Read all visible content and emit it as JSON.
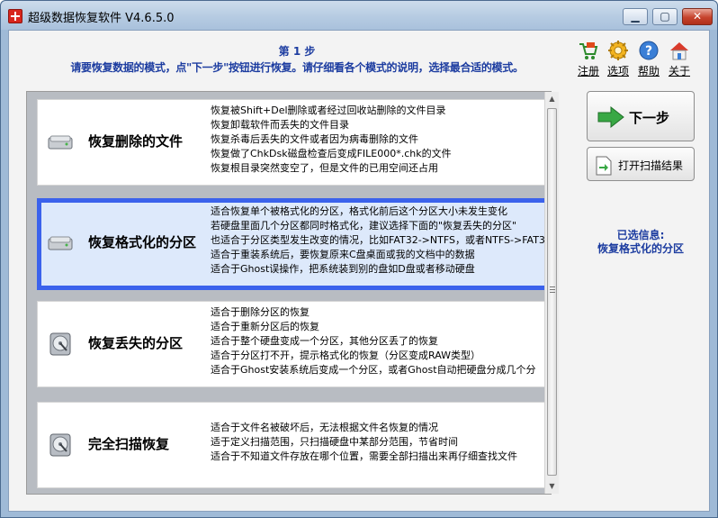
{
  "window": {
    "title": "超级数据恢复软件 V4.6.5.0"
  },
  "header": {
    "step": "第 1 步",
    "instruction": "请要恢复数据的模式，点\"下一步\"按钮进行恢复。请仔细看各个模式的说明，选择最合适的模式。"
  },
  "toolbar": [
    {
      "label": "注册",
      "icon": "cart-icon"
    },
    {
      "label": "选项",
      "icon": "gear-icon"
    },
    {
      "label": "帮助",
      "icon": "help-icon"
    },
    {
      "label": "关于",
      "icon": "home-icon"
    }
  ],
  "modes": [
    {
      "title": "恢复删除的文件",
      "icon": "disk-icon",
      "selected": false,
      "lines": [
        "恢复被Shift+Del删除或者经过回收站删除的文件目录",
        "恢复卸载软件而丢失的文件目录",
        "恢复杀毒后丢失的文件或者因为病毒删除的文件",
        "恢复做了ChkDsk磁盘检查后变成FILE000*.chk的文件",
        "恢复根目录突然变空了，但是文件的已用空间还占用"
      ]
    },
    {
      "title": "恢复格式化的分区",
      "icon": "disk-icon",
      "selected": true,
      "lines": [
        "适合恢复单个被格式化的分区，格式化前后这个分区大小未发生变化",
        "若硬盘里面几个分区都同时格式化，建议选择下面的\"恢复丢失的分区\"",
        "也适合于分区类型发生改变的情况，比如FAT32->NTFS，或者NTFS->FAT3",
        "适合于重装系统后，要恢复原来C盘桌面或我的文档中的数据",
        "适合于Ghost误操作，把系统装到别的盘如D盘或者移动硬盘"
      ]
    },
    {
      "title": "恢复丢失的分区",
      "icon": "harddrive-icon",
      "selected": false,
      "lines": [
        "适合于删除分区的恢复",
        "适合于重新分区后的恢复",
        "适合于整个硬盘变成一个分区，其他分区丢了的恢复",
        "适合于分区打不开，提示格式化的恢复（分区变成RAW类型）",
        "适合于Ghost安装系统后变成一个分区，或者Ghost自动把硬盘分成几个分"
      ]
    },
    {
      "title": "完全扫描恢复",
      "icon": "harddrive-icon",
      "selected": false,
      "lines": [
        "适合于文件名被破坏后，无法根据文件名恢复的情况",
        "适于定义扫描范围，只扫描硬盘中某部分范围，节省时间",
        "适合于不知道文件存放在哪个位置，需要全部扫描出来再仔细查找文件"
      ]
    }
  ],
  "actions": {
    "next_label": "下一步",
    "open_label": "打开扫描结果"
  },
  "selection": {
    "label": "已选信息:",
    "value": "恢复格式化的分区"
  },
  "colors": {
    "accent_text": "#1c3ca0",
    "selected_border": "#3b62ec",
    "selected_bg": "#dde9fb"
  }
}
